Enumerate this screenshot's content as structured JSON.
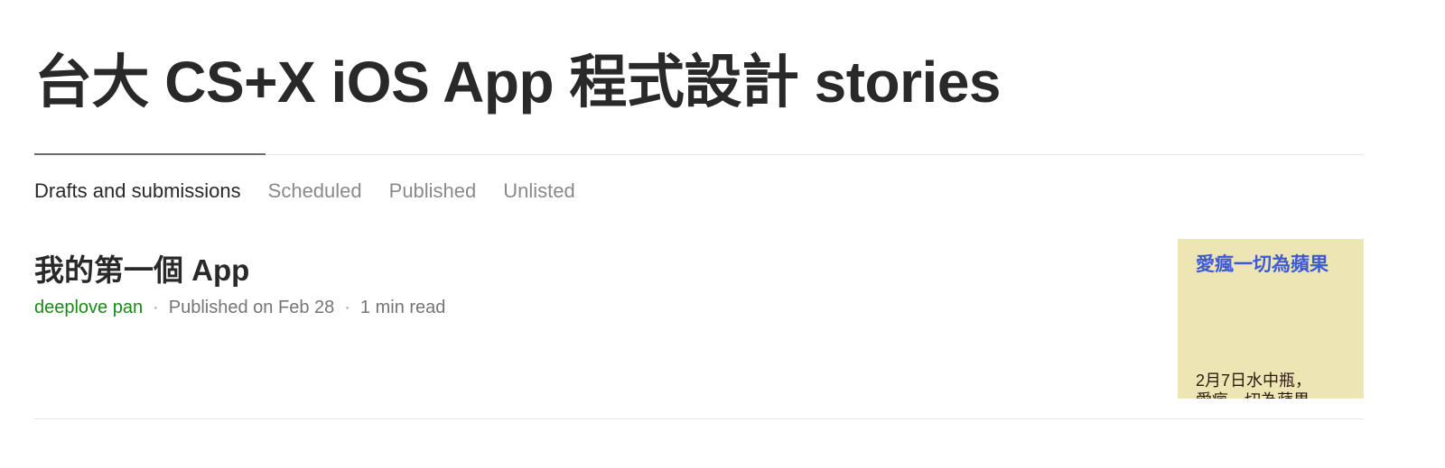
{
  "publication": {
    "title": "台大 CS+X iOS App 程式設計 stories"
  },
  "tabs": [
    {
      "label": "Drafts and submissions",
      "active": true
    },
    {
      "label": "Scheduled",
      "active": false
    },
    {
      "label": "Published",
      "active": false
    },
    {
      "label": "Unlisted",
      "active": false
    }
  ],
  "story": {
    "title": "我的第一個 App",
    "author": "deeplove pan",
    "published": "Published on Feb 28",
    "read_time": "1 min read",
    "separator": "·",
    "thumbnail": {
      "heading": "愛瘋一切為蘋果",
      "line1": "2月7日水中瓶，",
      "line2": "愛瘋一切為蘋果"
    }
  },
  "colors": {
    "author": "#1a8917",
    "thumbnail_bg": "#ede6b4",
    "thumbnail_heading": "#3d5bd6"
  }
}
